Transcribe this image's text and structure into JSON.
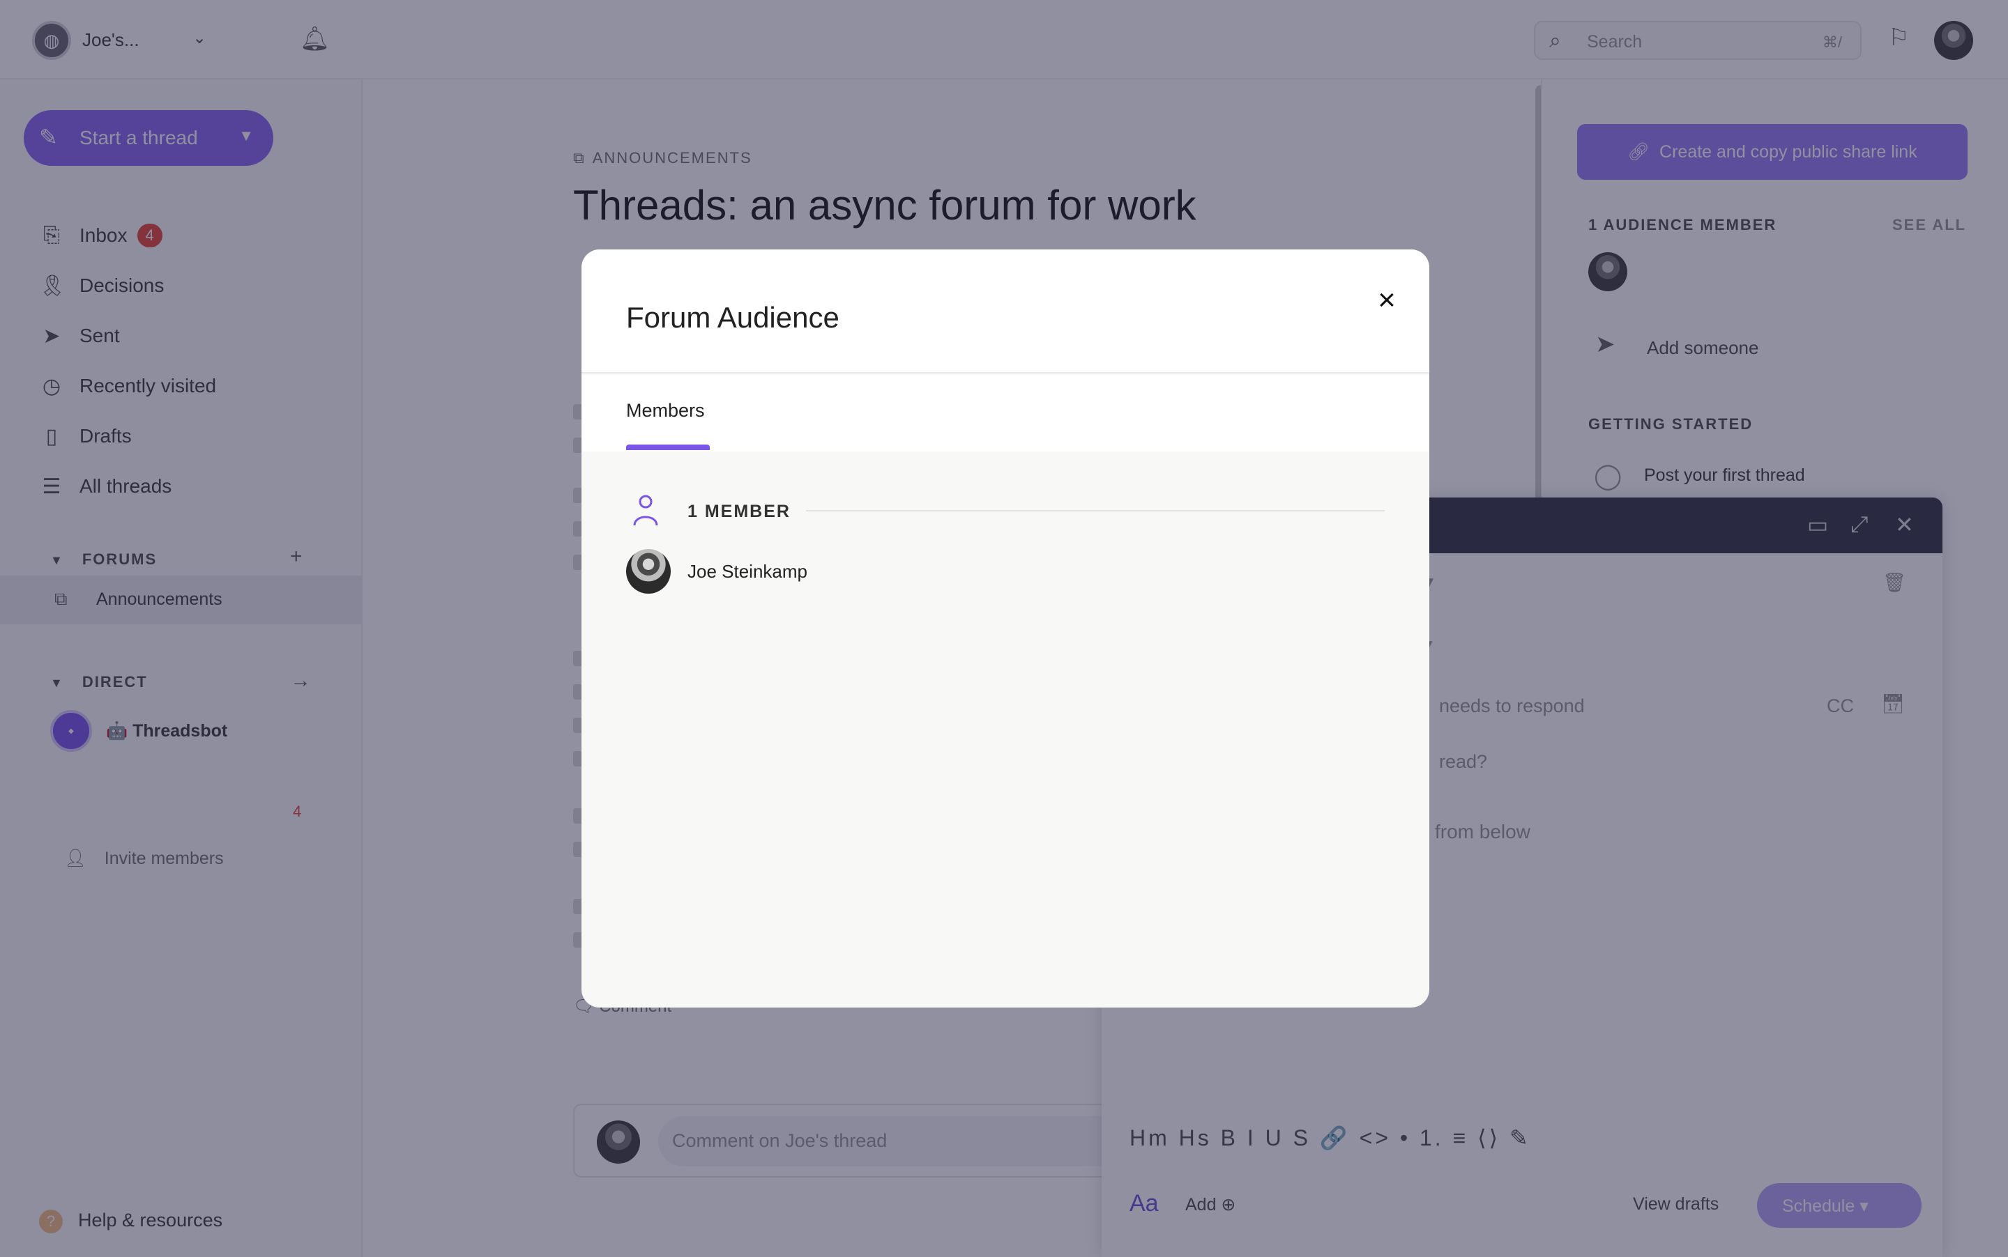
{
  "topbar": {
    "workspace_name": "Joe's...",
    "search_placeholder": "Search",
    "search_shortcut": "⌘/"
  },
  "sidebar": {
    "start_thread_label": "Start a thread",
    "nav": [
      {
        "label": "Inbox",
        "badge": "4"
      },
      {
        "label": "Decisions"
      },
      {
        "label": "Sent"
      },
      {
        "label": "Recently visited"
      },
      {
        "label": "Drafts"
      },
      {
        "label": "All threads"
      }
    ],
    "forums_heading": "FORUMS",
    "forum_items": [
      {
        "label": "Announcements"
      }
    ],
    "direct_heading": "DIRECT",
    "direct_items": [
      {
        "label": "🤖 Threadsbot",
        "badge": "4"
      }
    ],
    "invite_label": "Invite members",
    "help_label": "Help & resources"
  },
  "main": {
    "breadcrumb": "ANNOUNCEMENTS",
    "thread_title": "Threads: an async forum for work",
    "comment_button": "Comment",
    "comment_placeholder": "Comment on Joe's thread"
  },
  "right_panel": {
    "share_button": "Create and copy public share link",
    "audience_heading": "1 AUDIENCE MEMBER",
    "see_all": "SEE ALL",
    "add_someone": "Add someone",
    "getting_started_heading": "GETTING STARTED",
    "getting_started_item": "Post your first thread"
  },
  "composer": {
    "to_field_fragment": "n",
    "audience_fragment": "s",
    "respond_fragment": "needs to respond",
    "cc_label": "CC",
    "title_fragment": "read?",
    "body_fragment": "from below",
    "toolbar": [
      "Hm",
      "Hs",
      "B",
      "I",
      "U",
      "S",
      "🔗",
      "<>",
      "•",
      "1.",
      "≡",
      "⟨⟩",
      "✎"
    ],
    "format_label": "Aa",
    "add_label": "Add",
    "view_drafts": "View drafts",
    "schedule": "Schedule"
  },
  "modal": {
    "title": "Forum Audience",
    "tab": "Members",
    "member_count_heading": "1 MEMBER",
    "members": [
      {
        "name": "Joe Steinkamp"
      }
    ]
  },
  "colors": {
    "accent": "#7a55e6",
    "overlay": "rgba(26,22,58,0.48)",
    "badge": "#e74c3c"
  }
}
